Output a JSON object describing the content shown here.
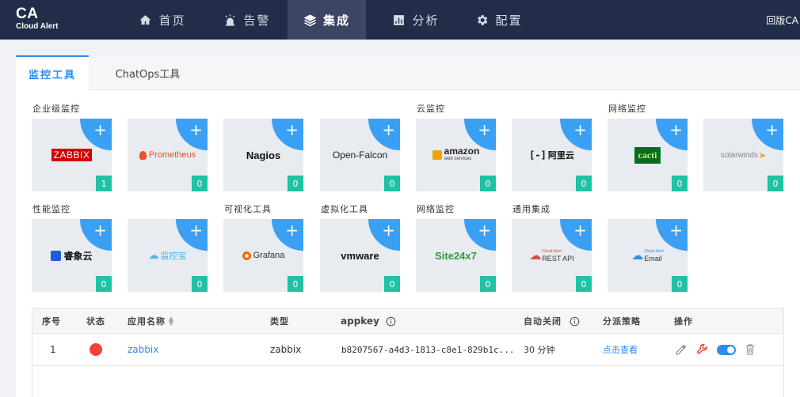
{
  "brand": {
    "main": "CA",
    "sub": "Cloud Alert"
  },
  "nav": [
    {
      "label": "首页",
      "icon": "home-icon"
    },
    {
      "label": "告警",
      "icon": "alarm-light-icon"
    },
    {
      "label": "集成",
      "icon": "layers-icon",
      "active": true
    },
    {
      "label": "分析",
      "icon": "bar-chart-icon"
    },
    {
      "label": "配置",
      "icon": "gear-icon"
    }
  ],
  "old_version": "回版CA",
  "tabs": [
    {
      "label": "监控工具",
      "active": true
    },
    {
      "label": "ChatOps工具",
      "active": false
    }
  ],
  "categories": {
    "enterprise": "企业级监控",
    "cloud": "云监控",
    "network1": "网络监控",
    "performance": "性能监控",
    "visualization": "可视化工具",
    "virtualization": "虚拟化工具",
    "network2": "网络监控",
    "general": "通用集成"
  },
  "cards": [
    {
      "name": "ZABBIX",
      "count": "1"
    },
    {
      "name": "Prometheus",
      "count": "0"
    },
    {
      "name": "Nagios",
      "count": "0"
    },
    {
      "name": "Open-Falcon",
      "count": "0"
    },
    {
      "name": "amazon",
      "sub": "web services",
      "count": "0"
    },
    {
      "name": "阿里云",
      "count": "0"
    },
    {
      "name": "cacti",
      "count": "0"
    },
    {
      "name": "solarwinds",
      "count": "0"
    },
    {
      "name": "睿象云",
      "count": "0"
    },
    {
      "name": "监控宝",
      "count": "0"
    },
    {
      "name": "Grafana",
      "count": "0"
    },
    {
      "name": "vmware",
      "count": "0"
    },
    {
      "name": "Site24x7",
      "count": "0"
    },
    {
      "name": "REST API",
      "sub": "Cloud Alert",
      "count": "0"
    },
    {
      "name": "Email",
      "sub": "Cloud Alert",
      "count": "0"
    }
  ],
  "colors": {
    "nav_bg": "#222d4a",
    "accent": "#2d8cf0",
    "corner": "#3aa0f3",
    "count_badge": "#1fc2a3",
    "zabbix": "#d40000",
    "prometheus": "#e6522c",
    "status_red": "#f5403a"
  },
  "table": {
    "headers": {
      "index": "序号",
      "status": "状态",
      "app_name": "应用名称",
      "type": "类型",
      "appkey": "appkey",
      "auto_close": "自动关闭",
      "strategy": "分派策略",
      "actions": "操作"
    },
    "rows": [
      {
        "index": "1",
        "status_color": "#f5403a",
        "app_name": "zabbix",
        "type": "zabbix",
        "appkey": "b8207567-a4d3-1813-c8e1-829b1c...",
        "auto_close": "30 分钟",
        "strategy": "点击查看",
        "toggle_on": true
      }
    ]
  }
}
